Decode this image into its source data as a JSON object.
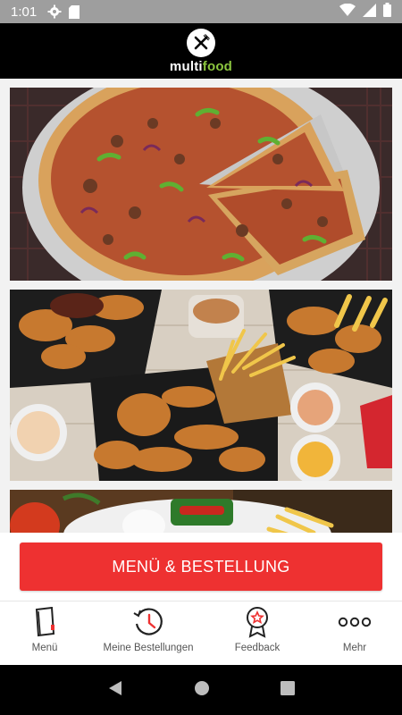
{
  "status_bar": {
    "time": "1:01",
    "left_icons": [
      "gear-icon",
      "sd-card-icon"
    ],
    "right_icons": [
      "wifi-icon",
      "signal-icon",
      "battery-icon"
    ]
  },
  "app": {
    "logo_part1": "multi",
    "logo_part2": "food",
    "logo_icon": "fork-knife-icon",
    "brand_green": "#8cc63f"
  },
  "feed": {
    "images": [
      {
        "name": "pizza-image"
      },
      {
        "name": "chicken-tenders-fries-image"
      },
      {
        "name": "grill-plate-image"
      }
    ]
  },
  "cta": {
    "label": "MENÜ & BESTELLUNG",
    "color": "#ee3131"
  },
  "tabs": [
    {
      "label": "Menü",
      "icon": "menu-book-icon"
    },
    {
      "label": "Meine Bestellungen",
      "icon": "history-icon"
    },
    {
      "label": "Feedback",
      "icon": "award-star-icon"
    },
    {
      "label": "Mehr",
      "icon": "more-dots-icon"
    }
  ],
  "nav_bar": {
    "buttons": [
      "back-icon",
      "home-icon",
      "recents-icon"
    ]
  }
}
